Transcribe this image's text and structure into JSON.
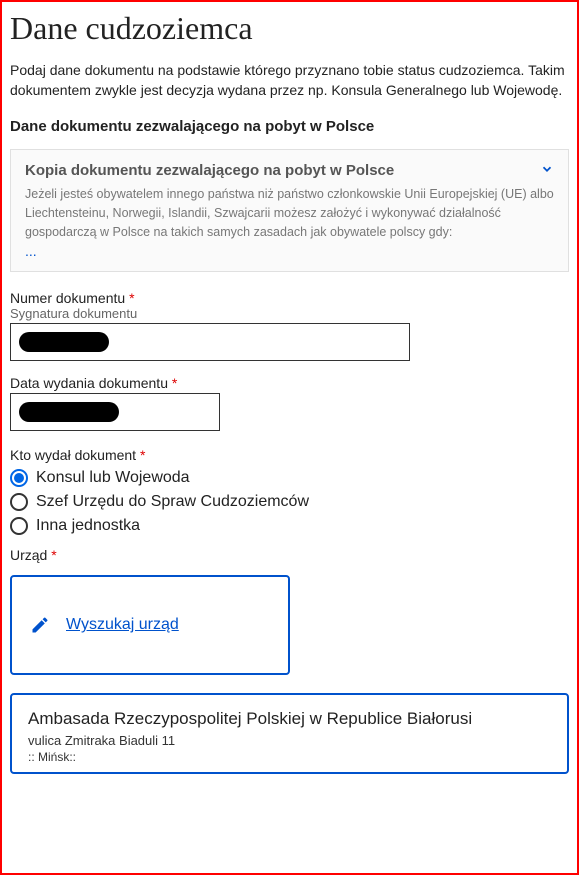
{
  "page": {
    "title": "Dane cudzoziemca",
    "intro": "Podaj dane dokumentu na podstawie którego przyznano tobie status cudzoziemca. Takim dokumentem zwykle jest decyzja wydana przez np. Konsula Generalnego lub Wojewodę."
  },
  "section": {
    "heading": "Dane dokumentu zezwalającego na pobyt w Polsce"
  },
  "accordion": {
    "title": "Kopia dokumentu zezwalającego na pobyt w Polsce",
    "body": "Jeżeli jesteś obywatelem innego państwa niż państwo członkowskie Unii Europejskiej (UE) albo Liechtensteinu, Norwegii, Islandii, Szwajcarii możesz założyć i wykonywać działalność gospodarczą w Polsce na takich samych zasadach jak obywatele polscy gdy:",
    "more": "..."
  },
  "fields": {
    "doc_number_label": "Numer dokumentu",
    "doc_number_hint": "Sygnatura dokumentu",
    "doc_date_label": "Data wydania dokumentu",
    "issuer_label": "Kto wydał dokument",
    "office_label": "Urząd",
    "required_marker": "*"
  },
  "radios": {
    "option1": "Konsul lub Wojewoda",
    "option2": "Szef Urzędu do Spraw Cudzoziemców",
    "option3": "Inna jednostka"
  },
  "search": {
    "button_label": "Wyszukaj urząd"
  },
  "selected_office": {
    "name": "Ambasada Rzeczypospolitej Polskiej w Republice Białorusi",
    "address": "vulica Zmitraka Biaduli 11",
    "city": ":: Mińsk::"
  }
}
